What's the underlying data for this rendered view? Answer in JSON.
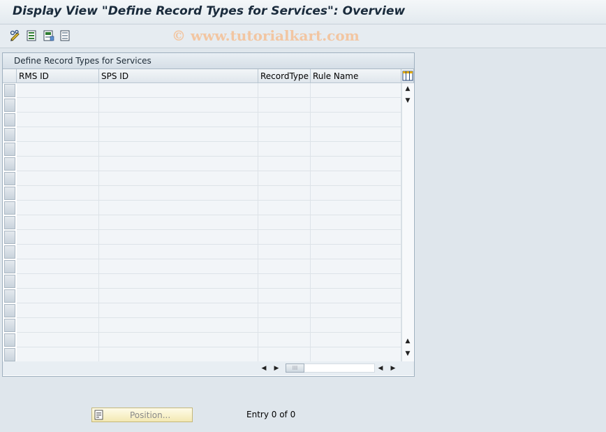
{
  "window": {
    "title": "Display View \"Define Record Types for Services\": Overview"
  },
  "toolbar": {
    "buttons": [
      {
        "icon": "change-pencil-icon"
      },
      {
        "icon": "select-all-icon"
      },
      {
        "icon": "select-block-icon"
      },
      {
        "icon": "deselect-all-icon"
      }
    ],
    "watermark": "© www.tutorialkart.com"
  },
  "table": {
    "title": "Define Record Types for Services",
    "columns": [
      "RMS ID",
      "SPS ID",
      "RecordType",
      "Rule Name"
    ],
    "settings_icon": "table-settings-icon",
    "rows": []
  },
  "footer": {
    "position_label": "Position...",
    "entry_text": "Entry 0 of 0"
  },
  "colors": {
    "background": "#dfe6ec",
    "position_button": "#f3e9b3",
    "watermark": "#f2c6a2"
  }
}
